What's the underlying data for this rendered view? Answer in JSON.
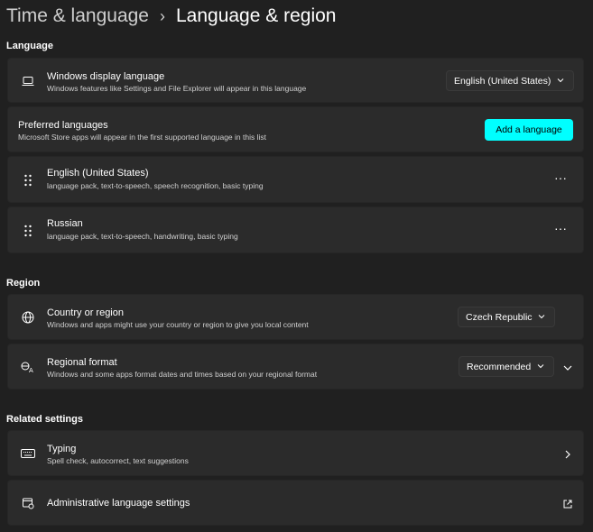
{
  "breadcrumb": {
    "parent": "Time & language",
    "separator": "›",
    "current": "Language & region"
  },
  "sections": {
    "language": "Language",
    "region": "Region",
    "related": "Related settings"
  },
  "display_language": {
    "title": "Windows display language",
    "subtitle": "Windows features like Settings and File Explorer will appear in this language",
    "value": "English (United States)",
    "icon": "laptop-icon"
  },
  "preferred": {
    "title": "Preferred languages",
    "subtitle": "Microsoft Store apps will appear in the first supported language in this list",
    "button": "Add a language"
  },
  "languages": [
    {
      "name": "English (United States)",
      "features": "language pack, text-to-speech, speech recognition, basic typing",
      "more": "···"
    },
    {
      "name": "Russian",
      "features": "language pack, text-to-speech, handwriting, basic typing",
      "more": "···"
    }
  ],
  "country": {
    "title": "Country or region",
    "subtitle": "Windows and apps might use your country or region to give you local content",
    "value": "Czech Republic",
    "icon": "globe-icon"
  },
  "format": {
    "title": "Regional format",
    "subtitle": "Windows and some apps format dates and times based on your regional format",
    "value": "Recommended",
    "icon": "regional-format-icon"
  },
  "typing": {
    "title": "Typing",
    "subtitle": "Spell check, autocorrect, text suggestions",
    "icon": "keyboard-icon"
  },
  "admin": {
    "title": "Administrative language settings",
    "icon": "admin-language-icon"
  },
  "colors": {
    "background": "#202020",
    "card": "#2b2b2b",
    "accent": "#00ffff"
  }
}
